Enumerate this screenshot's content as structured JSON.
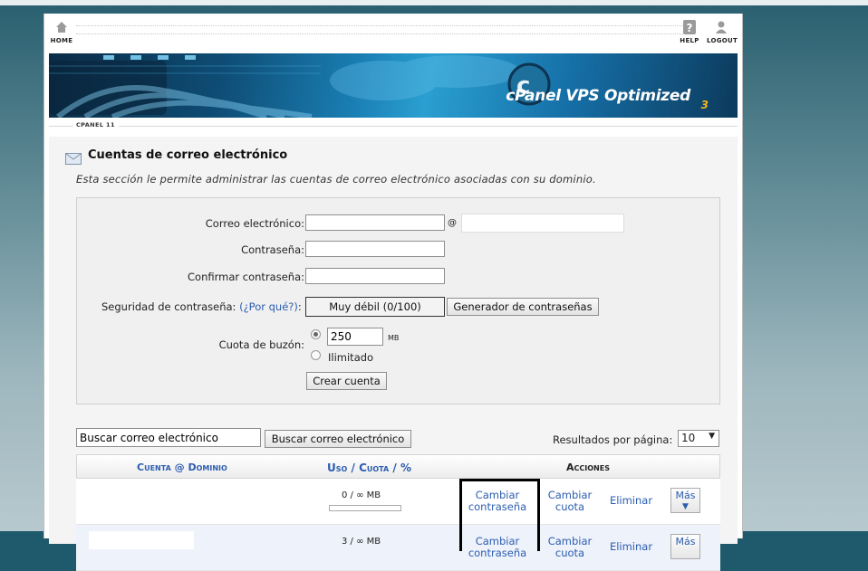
{
  "nav": {
    "home": "HOME",
    "help": "HELP",
    "logout": "LOGOUT"
  },
  "banner": {
    "brand_c": "cPanel",
    "brand_rest": " VPS Optimized",
    "version_digit": "3"
  },
  "version_label": "CPANEL 11",
  "page": {
    "title": "Cuentas de correo electrónico",
    "description": "Esta sección le permite administrar las cuentas de correo electrónico asociadas con su dominio."
  },
  "form": {
    "email_label": "Correo electrónico:",
    "at_sign": "@",
    "password_label": "Contraseña:",
    "confirm_label": "Confirmar contraseña:",
    "strength_label": "Seguridad de contraseña:",
    "why_link": "(¿Por qué?)",
    "strength_colon": ":",
    "strength_value": "Muy débil (0/100)",
    "generator_button": "Generador de contraseñas",
    "quota_label": "Cuota de buzón:",
    "quota_value": "250",
    "quota_unit": "MB",
    "unlimited_label": "Ilimitado",
    "create_button": "Crear cuenta"
  },
  "search": {
    "input_value": "Buscar correo electrónico",
    "button": "Buscar correo electrónico",
    "per_page_label": "Resultados por página:",
    "per_page_value": "10"
  },
  "table": {
    "headers": {
      "account": "Cuenta",
      "at": "@",
      "domain": "Dominio",
      "usage": "Uso",
      "slash1": "/",
      "quota": "Cuota",
      "slash2": "/",
      "percent": "%",
      "actions": "Acciones"
    },
    "rows": [
      {
        "usage": "0 / ∞ MB",
        "usage_fraction": 0,
        "change_password": "Cambiar contraseña",
        "change_quota": "Cambiar cuota",
        "delete": "Eliminar",
        "more": "Más"
      },
      {
        "usage": "3 / ∞ MB",
        "usage_fraction": 0,
        "change_password": "Cambiar contraseña",
        "change_quota": "Cambiar cuota",
        "delete": "Eliminar",
        "more": "Más"
      }
    ]
  }
}
